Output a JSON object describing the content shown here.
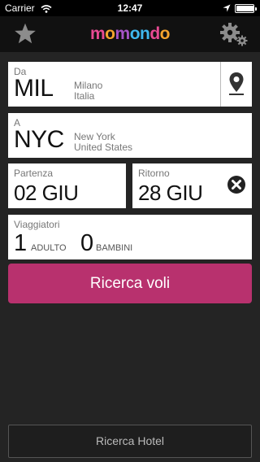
{
  "status_bar": {
    "carrier": "Carrier",
    "time": "12:47",
    "battery_level": 0.95
  },
  "nav": {
    "logo_letters": [
      {
        "char": "m",
        "color": "#e84a93"
      },
      {
        "char": "o",
        "color": "#f4a32d"
      },
      {
        "char": "m",
        "color": "#a653c7"
      },
      {
        "char": "o",
        "color": "#3fb8ee"
      },
      {
        "char": "n",
        "color": "#3fb8ee"
      },
      {
        "char": "d",
        "color": "#e84a93"
      },
      {
        "char": "o",
        "color": "#f4a32d"
      }
    ],
    "favorites_icon": "star-icon",
    "settings_icon": "gear-icon"
  },
  "from": {
    "label": "Da",
    "code": "MIL",
    "city": "Milano",
    "country": "Italia",
    "location_icon": "map-pin-icon"
  },
  "to": {
    "label": "A",
    "code": "NYC",
    "city": "New York",
    "country": "United States"
  },
  "departure": {
    "label": "Partenza",
    "date": "02 GIU"
  },
  "return": {
    "label": "Ritorno",
    "date": "28 GIU",
    "clear_icon": "close-circle-icon"
  },
  "travelers": {
    "label": "Viaggiatori",
    "adults_count": "1",
    "adults_label": "ADULTO",
    "children_count": "0",
    "children_label": "BAMBINI"
  },
  "search_button": {
    "label": "Ricerca voli",
    "color": "#b8316e"
  },
  "hotel_button": {
    "label": "Ricerca Hotel"
  }
}
